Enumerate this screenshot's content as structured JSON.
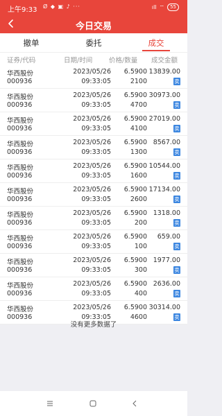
{
  "status_bar": {
    "time": "上午9:33",
    "tray": "Ø ◆ ▣ ♪ ···",
    "network": "ıll",
    "wifi": "⌔",
    "battery": "55"
  },
  "header": {
    "title": "今日交易"
  },
  "tabs": [
    {
      "label": "撤单"
    },
    {
      "label": "委托"
    },
    {
      "label": "成交"
    }
  ],
  "columns": {
    "stock": "证券/代码",
    "datetime": "日期/时间",
    "price_qty": "价格/数量",
    "amount": "成交金额"
  },
  "trades": [
    {
      "name": "华西股份",
      "code": "000936",
      "date": "2023/05/26",
      "time": "09:33:05",
      "price": "6.5900",
      "qty": "2100",
      "amount": "13839.00",
      "side": "卖"
    },
    {
      "name": "华西股份",
      "code": "000936",
      "date": "2023/05/26",
      "time": "09:33:05",
      "price": "6.5900",
      "qty": "4700",
      "amount": "30973.00",
      "side": "卖"
    },
    {
      "name": "华西股份",
      "code": "000936",
      "date": "2023/05/26",
      "time": "09:33:05",
      "price": "6.5900",
      "qty": "4100",
      "amount": "27019.00",
      "side": "卖"
    },
    {
      "name": "华西股份",
      "code": "000936",
      "date": "2023/05/26",
      "time": "09:33:05",
      "price": "6.5900",
      "qty": "1300",
      "amount": "8567.00",
      "side": "卖"
    },
    {
      "name": "华西股份",
      "code": "000936",
      "date": "2023/05/26",
      "time": "09:33:05",
      "price": "6.5900",
      "qty": "1600",
      "amount": "10544.00",
      "side": "卖"
    },
    {
      "name": "华西股份",
      "code": "000936",
      "date": "2023/05/26",
      "time": "09:33:05",
      "price": "6.5900",
      "qty": "2600",
      "amount": "17134.00",
      "side": "卖"
    },
    {
      "name": "华西股份",
      "code": "000936",
      "date": "2023/05/26",
      "time": "09:33:05",
      "price": "6.5900",
      "qty": "200",
      "amount": "1318.00",
      "side": "卖"
    },
    {
      "name": "华西股份",
      "code": "000936",
      "date": "2023/05/26",
      "time": "09:33:05",
      "price": "6.5900",
      "qty": "100",
      "amount": "659.00",
      "side": "卖"
    },
    {
      "name": "华西股份",
      "code": "000936",
      "date": "2023/05/26",
      "time": "09:33:05",
      "price": "6.5900",
      "qty": "300",
      "amount": "1977.00",
      "side": "卖"
    },
    {
      "name": "华西股份",
      "code": "000936",
      "date": "2023/05/26",
      "time": "09:33:05",
      "price": "6.5900",
      "qty": "400",
      "amount": "2636.00",
      "side": "卖"
    },
    {
      "name": "华西股份",
      "code": "000936",
      "date": "2023/05/26",
      "time": "09:33:05",
      "price": "6.5900",
      "qty": "4600",
      "amount": "30314.00",
      "side": "卖"
    }
  ],
  "footer": {
    "no_more": "没有更多数据了"
  },
  "colors": {
    "accent": "#e8453b",
    "sell_badge": "#3b86e0",
    "muted_text": "#999999"
  },
  "icons": {
    "back": "chevron-left-icon",
    "menu": "menu-icon",
    "home": "square-home-icon",
    "nav_back": "triangle-back-icon"
  }
}
